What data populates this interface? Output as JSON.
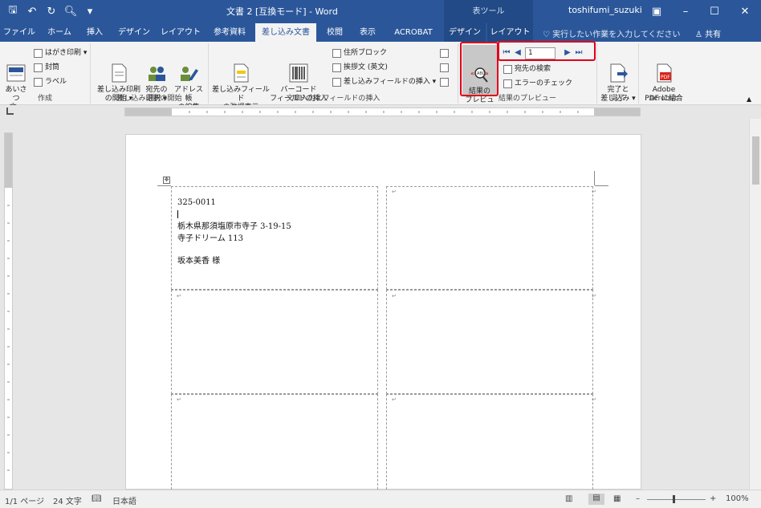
{
  "titlebar": {
    "doc_title": "文書 2 [互換モード] - Word",
    "context_tool": "表ツール",
    "user": "toshifumi_suzuki",
    "qat": {
      "save": "🖫",
      "undo": "↶",
      "redo": "↻",
      "preview": "🔍︎",
      "more": "▾"
    },
    "controls": {
      "ribbon_display": "▣",
      "minimize": "–",
      "maximize": "☐",
      "close": "✕"
    }
  },
  "tabs": [
    "ファイル",
    "ホーム",
    "挿入",
    "デザイン",
    "レイアウト",
    "参考資料",
    "差し込み文書",
    "校閲",
    "表示",
    "ACROBAT",
    "デザイン",
    "レイアウト"
  ],
  "tellme": "♡ 実行したい作業を入力してください",
  "share": "♙ 共有",
  "ribbon": {
    "create": {
      "name": "作成",
      "aisatsu": "あいさつ\n文 ▾",
      "hagaki": "はがき印刷 ▾",
      "envelope": "封筒",
      "label": "ラベル"
    },
    "start": {
      "name": "差し込み印刷の開始",
      "start_merge": "差し込み印刷\nの開始 ▾",
      "select_recipients": "宛先の\n選択 ▾",
      "edit_list": "アドレス帳\nの編集"
    },
    "write": {
      "name": "文章入力とフィールドの挿入",
      "highlight": "差し込みフィールド\nの強調表示",
      "barcode": "バーコード\nフィールドの挿入 ▾",
      "address_block": "住所ブロック",
      "greeting": "挨拶文 (英文)",
      "insert_field": "差し込みフィールドの挿入 ▾"
    },
    "preview": {
      "name": "結果のプレビュー",
      "preview_results": "結果の\nプレビュー",
      "record_number": "1",
      "find_recipient": "宛先の検索",
      "check_errors": "エラーのチェック"
    },
    "finish": {
      "name": "完了",
      "finish_merge": "完了と\n差し込み ▾"
    },
    "acrobat": {
      "name": "Acrobat",
      "merge_pdf": "Adobe\nPDF に結合"
    }
  },
  "document": {
    "label": {
      "postal": "325-0011",
      "address1": "栃木県那須塩原市寺子 3-19-15",
      "address2": "寺子ドリーム 113",
      "name": "坂本美香 様"
    }
  },
  "status": {
    "page": "1/1 ページ",
    "words": "24 文字",
    "lang": "日本語",
    "zoom": "100%"
  }
}
